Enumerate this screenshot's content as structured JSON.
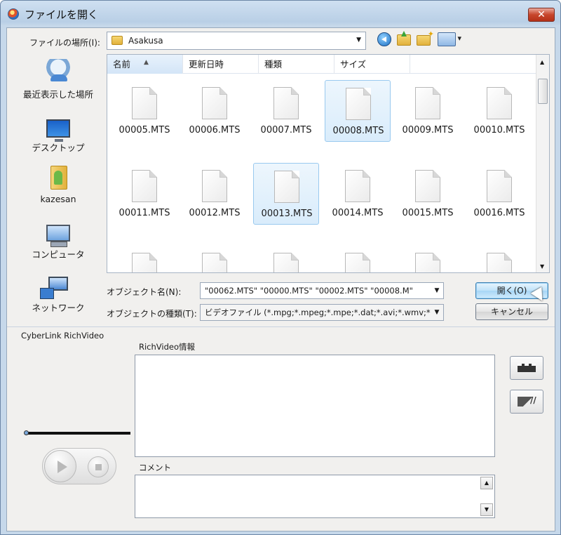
{
  "window": {
    "title": "ファイルを開く",
    "close_label": "✕"
  },
  "location": {
    "label": "ファイルの場所(I):",
    "value": "Asakusa"
  },
  "places": [
    {
      "label": "最近表示した場所",
      "icon": "recent-places-icon"
    },
    {
      "label": "デスクトップ",
      "icon": "desktop-icon"
    },
    {
      "label": "kazesan",
      "icon": "user-folder-icon"
    },
    {
      "label": "コンピュータ",
      "icon": "computer-icon"
    },
    {
      "label": "ネットワーク",
      "icon": "network-icon"
    }
  ],
  "columns": [
    "名前",
    "更新日時",
    "種類",
    "サイズ"
  ],
  "files": [
    {
      "name": "00005.MTS",
      "selected": false
    },
    {
      "name": "00006.MTS",
      "selected": false
    },
    {
      "name": "00007.MTS",
      "selected": false
    },
    {
      "name": "00008.MTS",
      "selected": true
    },
    {
      "name": "00009.MTS",
      "selected": false
    },
    {
      "name": "00010.MTS",
      "selected": false
    },
    {
      "name": "00011.MTS",
      "selected": false
    },
    {
      "name": "00012.MTS",
      "selected": false
    },
    {
      "name": "00013.MTS",
      "selected": true
    },
    {
      "name": "00014.MTS",
      "selected": false
    },
    {
      "name": "00015.MTS",
      "selected": false
    },
    {
      "name": "00016.MTS",
      "selected": false
    }
  ],
  "object_name": {
    "label": "オブジェクト名(N):",
    "value": "\"00062.MTS\" \"00000.MTS\" \"00002.MTS\" \"00008.M\""
  },
  "object_type": {
    "label": "オブジェクトの種類(T):",
    "value": "ビデオファイル (*.mpg;*.mpeg;*.mpe;*.dat;*.avi;*.wmv;*.a"
  },
  "buttons": {
    "open": "開く(O)",
    "cancel": "キャンセル"
  },
  "richvideo": {
    "section_title": "CyberLink RichVideo",
    "info_label": "RichVideo情報",
    "comment_label": "コメント"
  },
  "colors": {
    "title_gradient_top": "#cfe0f1",
    "client_bg": "#f1f0ee",
    "selection": "#d9ecfb",
    "close_button": "#c7452b"
  }
}
